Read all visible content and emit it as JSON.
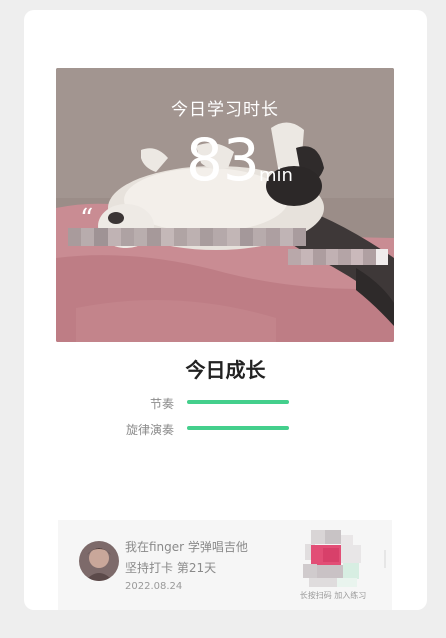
{
  "share_card": {
    "today_label": "今日学习时长",
    "minutes": "83",
    "minutes_unit": "min",
    "quote_mark": "“"
  },
  "growth": {
    "title": "今日成长",
    "metrics": [
      {
        "label": "节奏",
        "progress": 1.0
      },
      {
        "label": "旋律演奏",
        "progress": 1.0
      }
    ]
  },
  "footer": {
    "line1": "我在finger 学弹唱吉他",
    "line2": "坚持打卡 第21天",
    "date": "2022.08.24",
    "qr_caption": "长按扫码 加入练习"
  },
  "colors": {
    "accent": "#44cf8c",
    "background": "#eeeeee",
    "card": "#ffffff"
  },
  "icons": {
    "avatar": "avatar-photo",
    "qr": "qr-code-icon",
    "quote": "quote-mark-icon"
  }
}
